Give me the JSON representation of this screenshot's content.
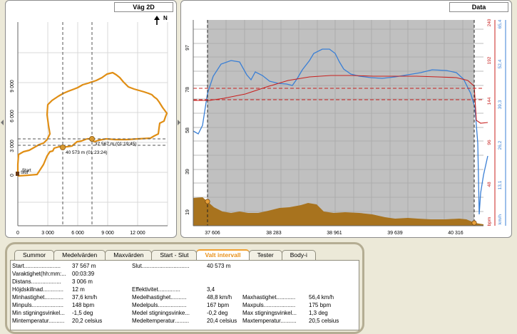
{
  "map": {
    "title": "Väg 2D",
    "north": "N",
    "y_ticks": [
      "9 000",
      "6 000",
      "3 000",
      "0"
    ],
    "x_ticks": [
      "0",
      "3 000",
      "6 000",
      "9 000",
      "12 000"
    ],
    "start_label": "Start",
    "end_label": "Slut",
    "marker_a": "37 567 m (01:19:45)",
    "marker_b": "40 573 m (01:23:24)",
    "route_color": "#e08e14"
  },
  "data_panel": {
    "title": "Data",
    "left_ticks": [
      "97",
      "78",
      "58",
      "39",
      "19"
    ],
    "red_ticks": [
      "240",
      "192",
      "144",
      "96",
      "48"
    ],
    "red_unit": "bpm",
    "blue_ticks": [
      "65,4",
      "52,4",
      "39,3",
      "26,2",
      "13,1"
    ],
    "blue_unit": "km/h",
    "x_ticks": [
      "37 606",
      "38 283",
      "38 961",
      "39 639",
      "40 316"
    ],
    "colors": {
      "speed": "#3a7fd5",
      "pulse": "#c8201e",
      "altitude": "#a8731e",
      "selection": "#c0c0c0"
    }
  },
  "tabs": [
    {
      "label": "Summor",
      "active": false
    },
    {
      "label": "Medelvärden",
      "active": false
    },
    {
      "label": "Maxvärden",
      "active": false
    },
    {
      "label": "Start - Slut",
      "active": false
    },
    {
      "label": "Valt intervall",
      "active": true
    },
    {
      "label": "Tester",
      "active": false
    },
    {
      "label": "Body-i",
      "active": false
    }
  ],
  "stats": {
    "start_label": "Start.......................",
    "start_value": "37 567 m",
    "duration_label": "Varaktighet(hh:mm:...",
    "duration_value": "00:03:39",
    "distance_label": "Distans...................",
    "distance_value": "3 006 m",
    "alt_diff_label": "Höjdskillnad.............",
    "alt_diff_value": "12 m",
    "min_speed_label": "Minhastighet............",
    "min_speed_value": "37,6 km/h",
    "min_pulse_label": "Minpuls....................",
    "min_pulse_value": "148 bpm",
    "min_incline_label": "Min stigningsvinkel...",
    "min_incline_value": "-1,5 deg",
    "min_temp_label": "Mintemperatur..........",
    "min_temp_value": "20,2 celsius",
    "end_label": "Slut..............................",
    "end_value": "40 573 m",
    "effect_label": "Effektivitet..............",
    "effect_value": "3,4",
    "avg_speed_label": "Medelhastighet..........",
    "avg_speed_value": "48,8 km/h",
    "avg_pulse_label": "Medelpuls..................",
    "avg_pulse_value": "167 bpm",
    "avg_incline_label": "Medel stigningsvinke...",
    "avg_incline_value": "-0,2 deg",
    "avg_temp_label": "Medeltemperatur.........",
    "avg_temp_value": "20,4 celsius",
    "max_speed_label": "Maxhastighet............",
    "max_speed_value": "56,4 km/h",
    "max_pulse_label": "Maxpuls....................",
    "max_pulse_value": "175 bpm",
    "max_incline_label": "Max stigningsvinkel...",
    "max_incline_value": "1,3 deg",
    "max_temp_label": "Maxtemperatur..........",
    "max_temp_value": "20,5 celsius"
  }
}
